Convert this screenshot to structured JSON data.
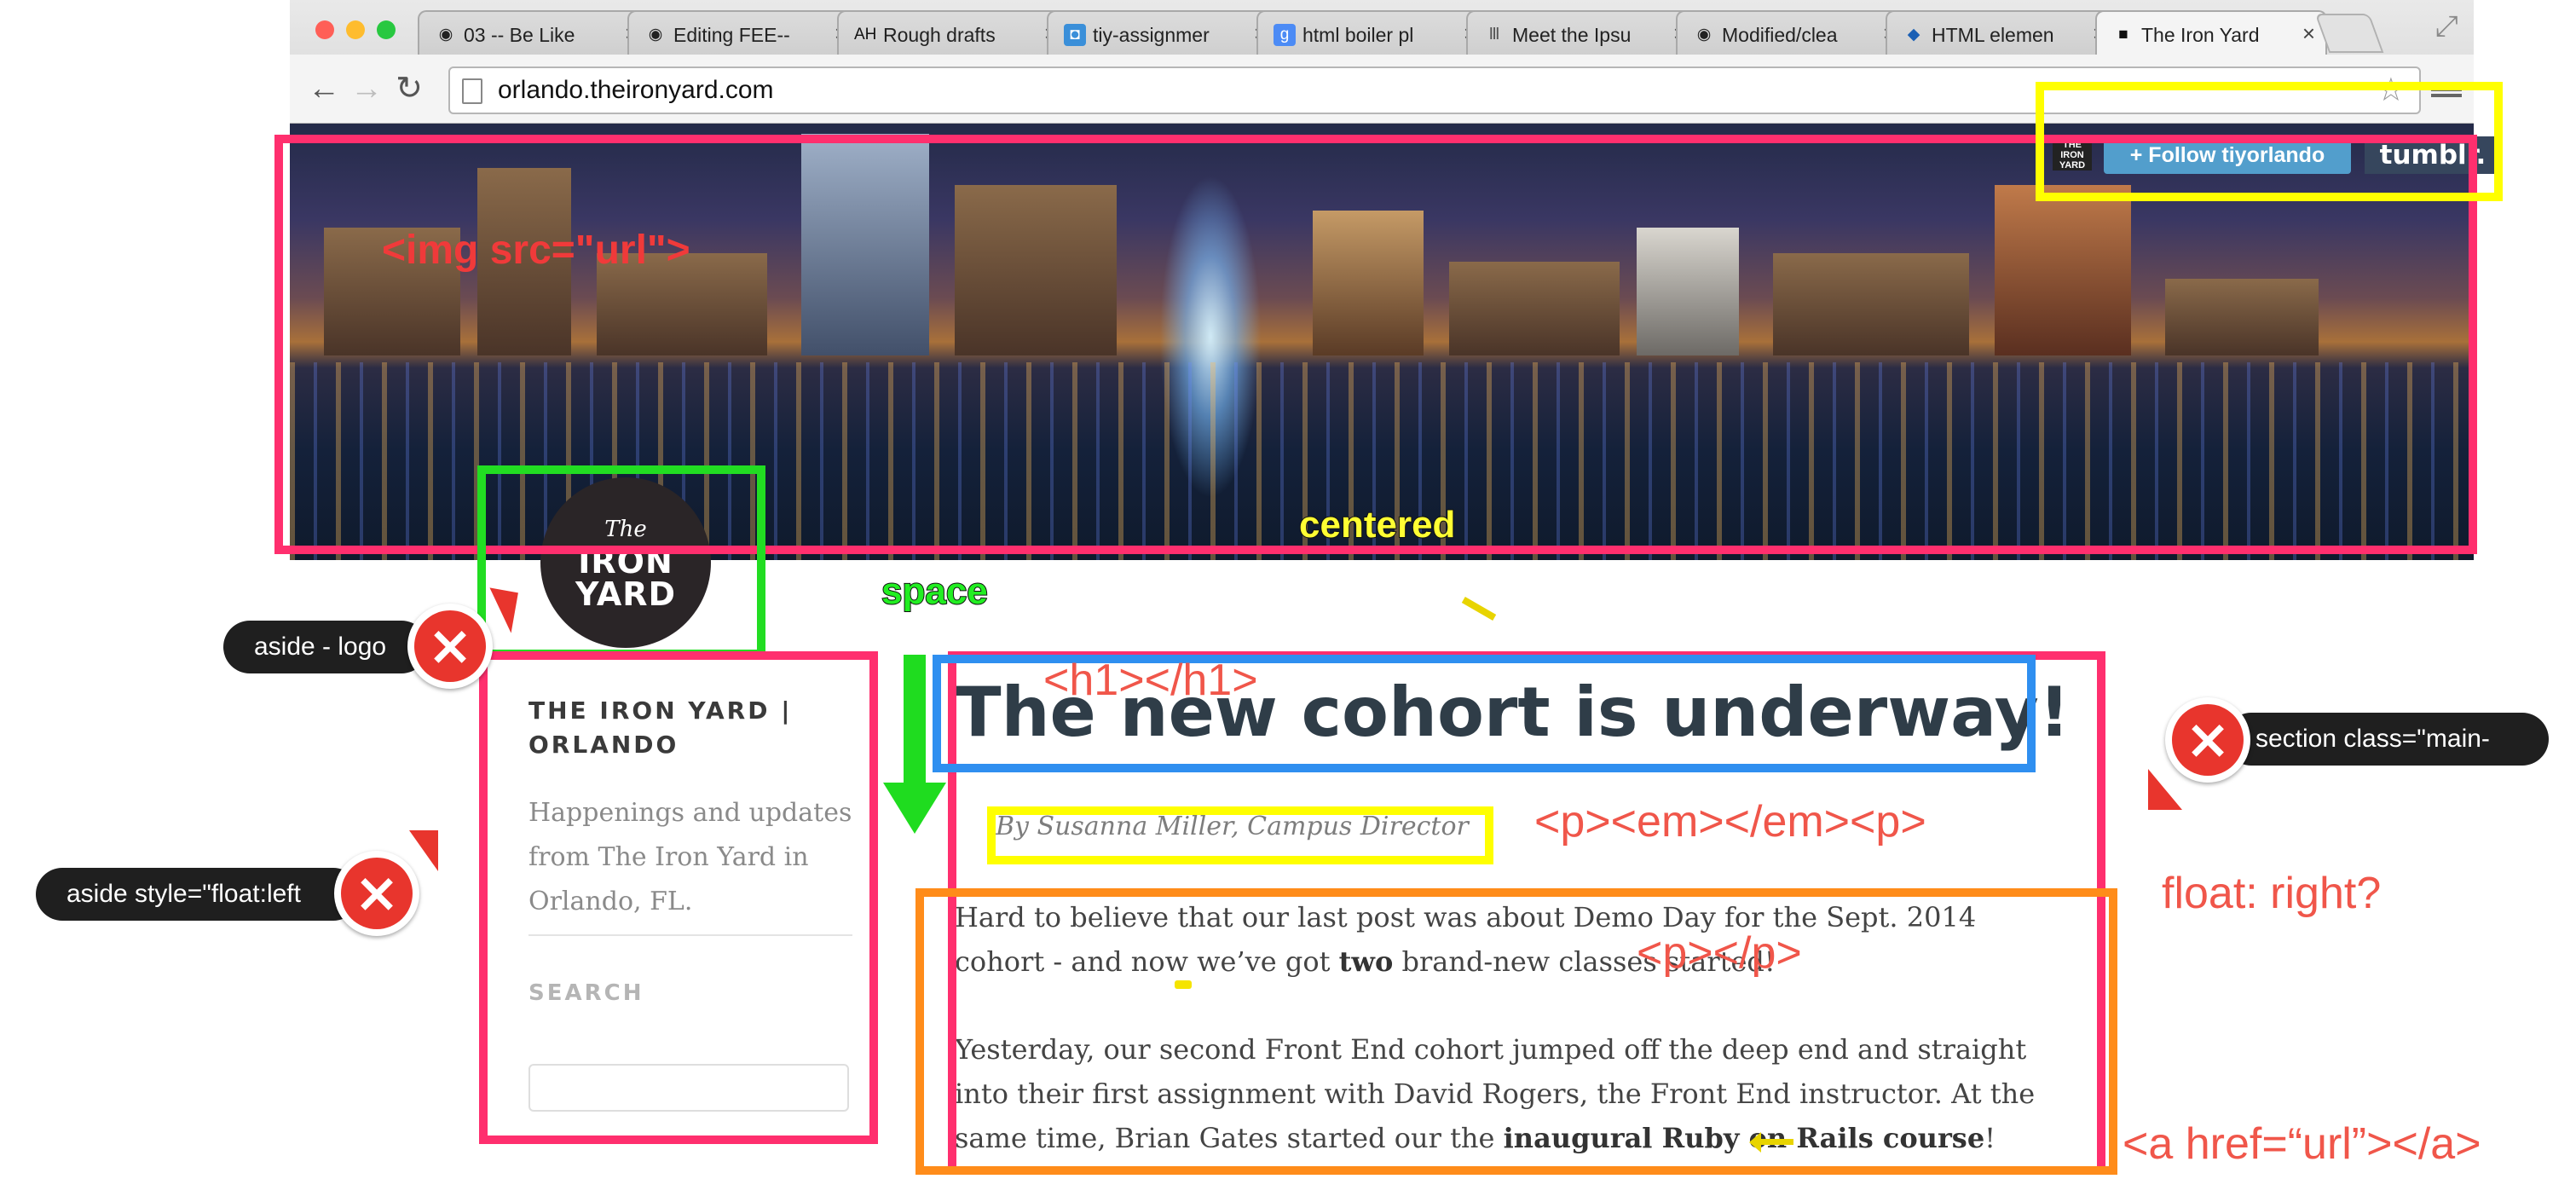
{
  "browser": {
    "traffic_lights": [
      {
        "name": "close",
        "color": "#ff5f57"
      },
      {
        "name": "minimize",
        "color": "#febc2e"
      },
      {
        "name": "zoom",
        "color": "#28c840"
      }
    ],
    "tabs": [
      {
        "title": "03 -- Be Like",
        "icon": "github-icon",
        "glyph": "◉",
        "color": "#222222",
        "bg": "transparent"
      },
      {
        "title": "Editing FEE--",
        "icon": "github-icon",
        "glyph": "◉",
        "color": "#222222",
        "bg": "transparent"
      },
      {
        "title": "Rough drafts",
        "icon": "ah-icon",
        "glyph": "AH",
        "color": "#111111",
        "bg": "transparent"
      },
      {
        "title": "tiy-assignmer",
        "icon": "photo-icon",
        "glyph": "◘",
        "color": "#ffffff",
        "bg": "#3a8fd9"
      },
      {
        "title": "html boiler pl",
        "icon": "google-icon",
        "glyph": "g",
        "color": "#ffffff",
        "bg": "#4c8bf5"
      },
      {
        "title": "Meet the Ipsu",
        "icon": "columns-icon",
        "glyph": "Ⅲ",
        "color": "#555555",
        "bg": "transparent"
      },
      {
        "title": "Modified/clea",
        "icon": "github-icon",
        "glyph": "◉",
        "color": "#222222",
        "bg": "transparent"
      },
      {
        "title": "HTML elemen",
        "icon": "mdn-icon",
        "glyph": "◆",
        "color": "#1a5fb4",
        "bg": "transparent"
      },
      {
        "title": "The Iron Yard",
        "icon": "ironyard-icon",
        "glyph": "■",
        "color": "#111111",
        "bg": "transparent"
      }
    ],
    "address": "orlando.theironyard.com"
  },
  "tumblr": {
    "follow_label": "+ Follow tiyorlando",
    "logo_text": "tumblr.",
    "mini_logo": "THE IRON YARD"
  },
  "logo": {
    "line1": "The",
    "line2": "IRON",
    "line3": "YARD"
  },
  "sidebar": {
    "title": "THE IRON YARD | ORLANDO",
    "description": "Happenings and updates from The Iron Yard in Orlando, FL.",
    "search_label": "SEARCH",
    "search_placeholder": ""
  },
  "post": {
    "title": "The new cohort is underway!",
    "byline": "By Susanna Miller, Campus Director",
    "p1_before": "Hard to believe that our last post was about Demo Day for the Sept. 2014 cohort - and now we’ve got ",
    "p1_bold": "two",
    "p1_after": " brand-new classes started!",
    "p2_before": "Yesterday, our second Front End cohort jumped off the deep end and straight into their first assignment with David Rogers, the Front End instructor. At the same time, Brian Gates started our the ",
    "p2_bold": "inaugural Ruby on Rails course",
    "p2_after": "!"
  },
  "annotations": {
    "img_tag": "<img src=\"url\">",
    "centered": "centered",
    "space": "space",
    "h1_tag": "<h1></h1>",
    "pem_tag": "<p><em></em><p>",
    "p_tag": "<p></p>",
    "float_right": "float: right?",
    "a_tag": "<a href=“url”></a>",
    "pill_logo": "aside - logo",
    "pill_aside": "aside style=\"float:left",
    "pill_section": "section class=\"main-",
    "x_glyph": "×",
    "colors": {
      "pink": "#ff2f6e",
      "yellow": "#ffff00",
      "green": "#22dd22",
      "blue": "#2f8ff0",
      "orange": "#ff8c1a",
      "red_text": "#f0564a"
    }
  }
}
